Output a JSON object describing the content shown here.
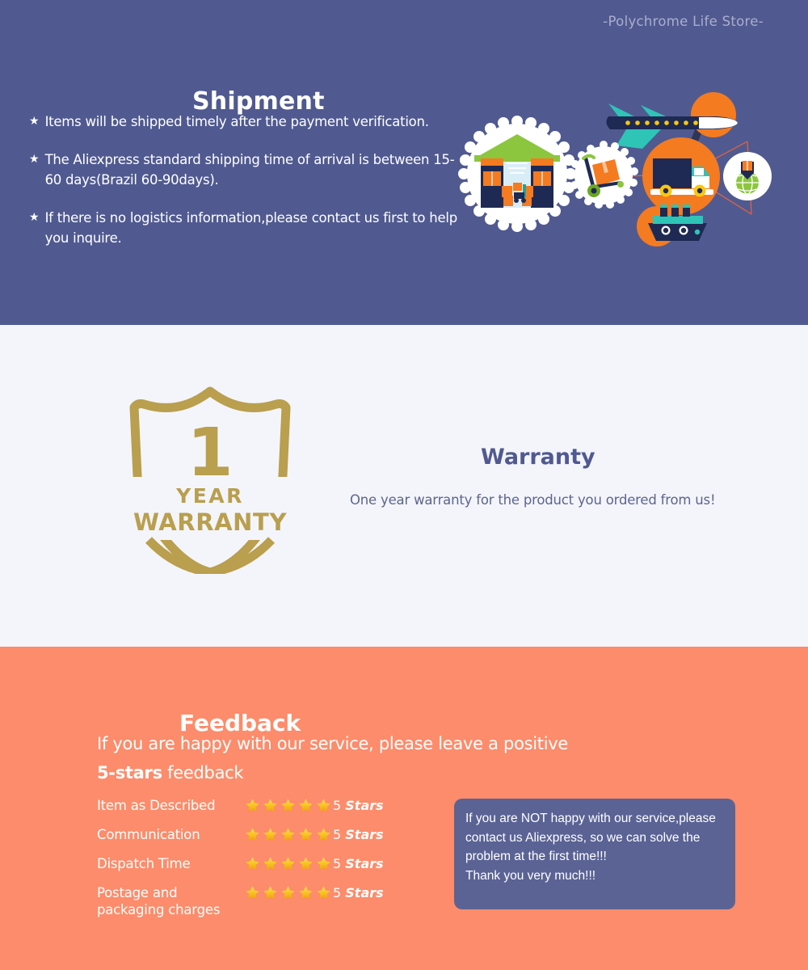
{
  "store": {
    "name": "-Polychrome Life Store-"
  },
  "shipment": {
    "title": "Shipment",
    "bullet_marker": "★",
    "bullets": [
      "Items will be shipped timely after the payment verification.",
      "The Aliexpress standard shipping time of arrival is between 15-60 days(Brazil 60-90days).",
      "If there is no logistics information,please contact us first to help you inquire."
    ],
    "illustration": {
      "icons": [
        "warehouse-icon",
        "hand-truck-icon",
        "airplane-icon",
        "delivery-truck-icon",
        "cargo-ship-icon",
        "globe-pin-icon"
      ]
    },
    "colors": {
      "background": "#505a90",
      "text": "#ffffff",
      "store_name": "#a9aecd"
    }
  },
  "warranty": {
    "badge": {
      "number": "1",
      "year_label": "YEAR",
      "warranty_label": "WARRANTY",
      "color": "#b99f4e"
    },
    "title": "Warranty",
    "description": "One year warranty for the product you ordered from us!",
    "colors": {
      "background": "#f4f5fa",
      "title": "#505a90",
      "text": "#5c6590"
    }
  },
  "feedback": {
    "title": "Feedback",
    "line1": "If you are happy with our service, please leave a positive",
    "line2_bold": "5-stars",
    "line2_rest": " feedback",
    "star_count": 5,
    "ratings": [
      {
        "label": "Item as Described",
        "stars": 5,
        "count": "5",
        "unit": "Stars"
      },
      {
        "label": "Communication",
        "stars": 5,
        "count": "5",
        "unit": "Stars"
      },
      {
        "label": "Dispatch Time",
        "stars": 5,
        "count": "5",
        "unit": "Stars"
      },
      {
        "label": "Postage and\npackaging charges",
        "stars": 5,
        "count": "5",
        "unit": "Stars"
      }
    ],
    "callout": "If you are NOT happy with our service,please contact us Aliexpress, so we can solve the problem at the first time!!!\nThank you very much!!!",
    "colors": {
      "background": "#fc8c6b",
      "text": "#ffffff",
      "callout_background": "#5a6394",
      "star": "#fcc52b"
    }
  }
}
